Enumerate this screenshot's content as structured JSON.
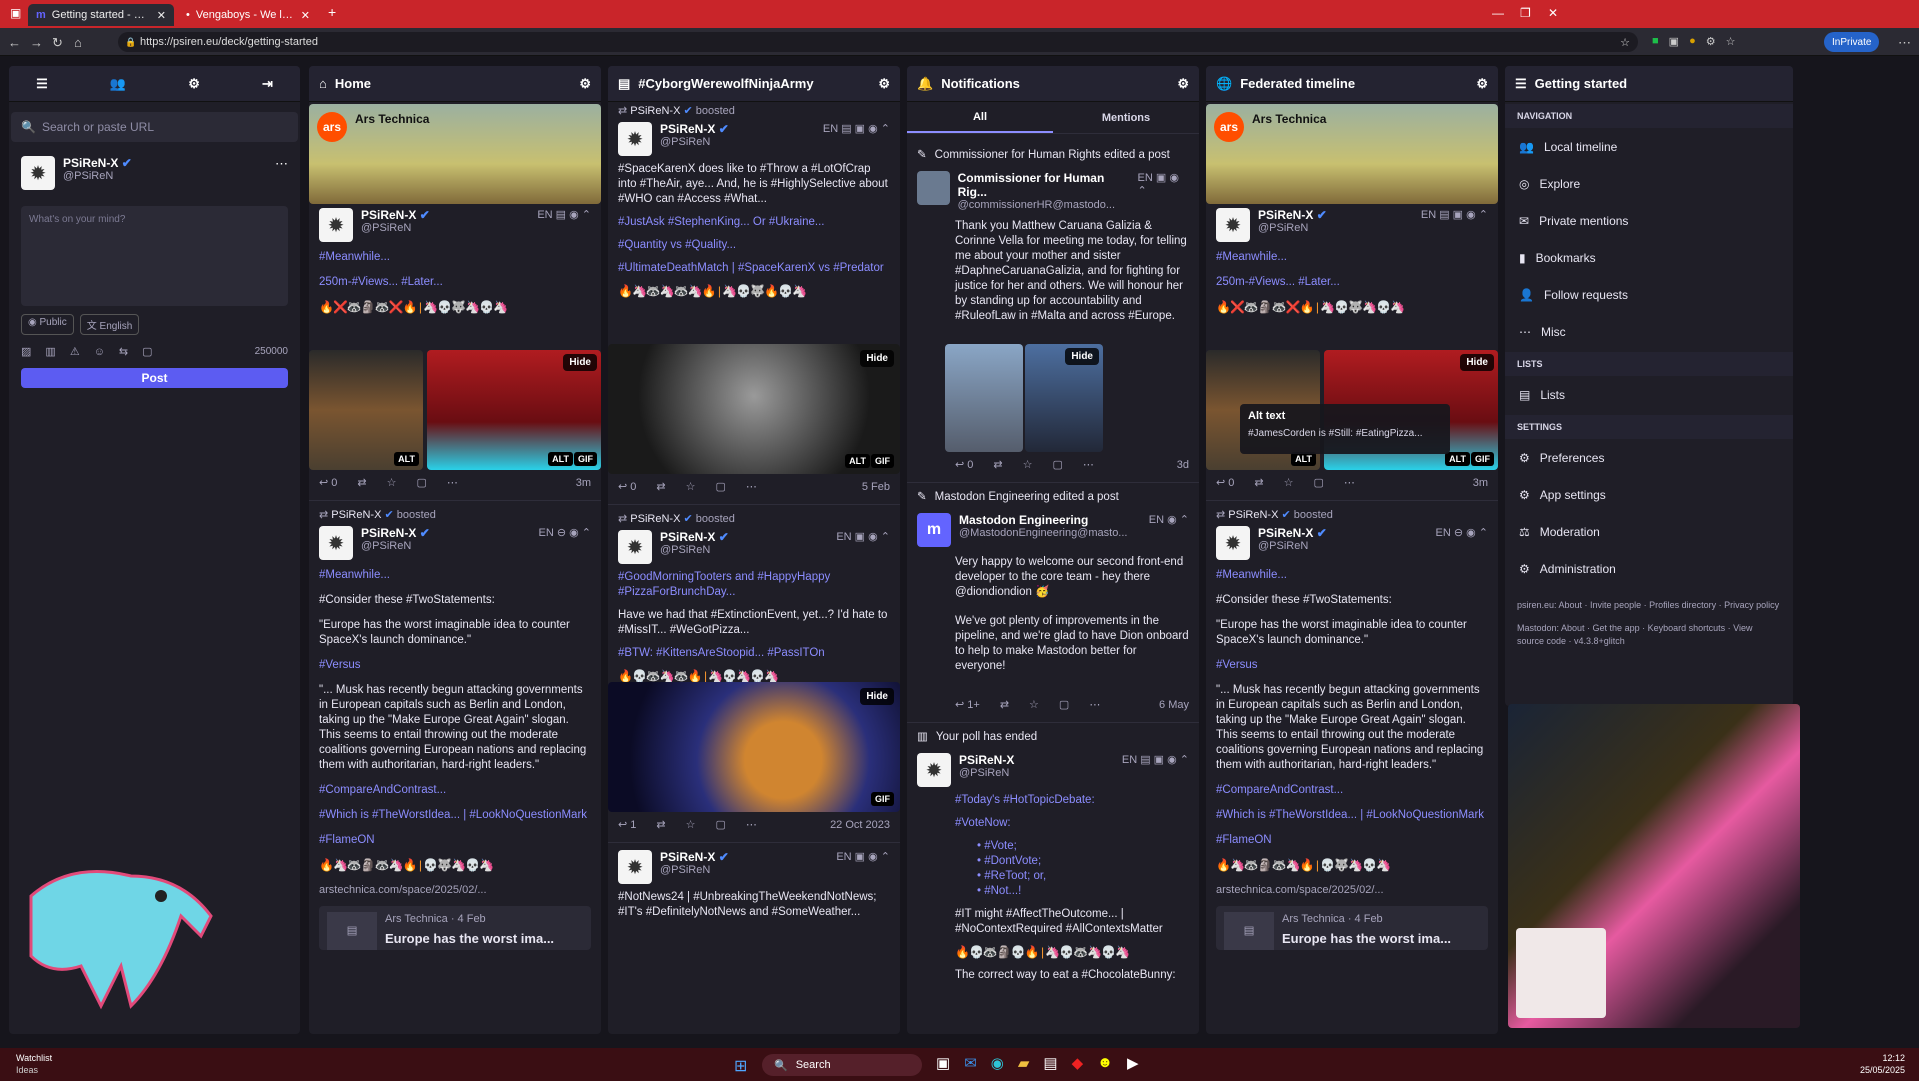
{
  "browser": {
    "tabs": [
      {
        "title": "Getting started - #MastodonSpy",
        "active": true
      },
      {
        "title": "Vengaboys - We like to Party! (Th",
        "active": false
      }
    ],
    "url": "https://psiren.eu/deck/getting-started",
    "inprivate": "InPrivate",
    "accent": "#c9252a"
  },
  "sidebar": {
    "search_placeholder": "Search or paste URL",
    "profile": {
      "name": "PSiReN-X",
      "handle": "@PSiReN"
    },
    "compose_placeholder": "What's on your mind?",
    "visibility": "Public",
    "language": "English",
    "char_count": "250000",
    "post_label": "Post"
  },
  "columns": {
    "home": {
      "title": "Home",
      "card": {
        "source": "Ars Technica"
      },
      "post1": {
        "name": "PSiReN-X",
        "handle": "@PSiReN",
        "lang": "EN",
        "lines": [
          "#Meanwhile...",
          "250m-#Views... #Later..."
        ],
        "hide": "Hide",
        "alt": "ALT",
        "alt2": "ALT",
        "gif": "GIF",
        "replies": "0",
        "time": "3m"
      },
      "boost": {
        "label": "PSiReN-X",
        "boosted": "boosted"
      },
      "post2": {
        "name": "PSiReN-X",
        "handle": "@PSiReN",
        "lang": "EN",
        "lines": [
          "#Meanwhile...",
          "#Consider these #TwoStatements:",
          "\"Europe has the worst imaginable idea to counter SpaceX's launch dominance.\"",
          "#Versus",
          "\"... Musk has recently begun attacking governments in European capitals such as Berlin and London, taking up the \"Make Europe Great Again\" slogan. This seems to entail throwing out the moderate coalitions governing European nations and replacing them with authoritarian, hard-right leaders.\"",
          "#CompareAndContrast...",
          "#Which is #TheWorstIdea... | #LookNoQuestionMark",
          "#FlameON"
        ],
        "link": "arstechnica.com/space/2025/02/...",
        "preview_source": "Ars Technica · 4 Feb",
        "preview_title": "Europe has the worst ima..."
      }
    },
    "cyborg": {
      "title": "#CyborgWerewolfNinjaArmy",
      "boost1": {
        "label": "PSiReN-X",
        "boosted": "boosted"
      },
      "post1": {
        "name": "PSiReN-X",
        "handle": "@PSiReN",
        "lang": "EN",
        "lines": [
          "#SpaceKarenX does like to #Throw a #LotOfCrap into #TheAir, aye... And, he is #HighlySelective about #WHO can #Access #What...",
          "#JustAsk #StephenKing... Or #Ukraine...",
          "#Quantity vs #Quality...",
          "#UltimateDeathMatch | #SpaceKarenX vs #Predator"
        ],
        "hide": "Hide",
        "alt": "ALT",
        "gif": "GIF",
        "replies": "0",
        "time": "5 Feb"
      },
      "boost2": {
        "label": "PSiReN-X",
        "boosted": "boosted"
      },
      "post2": {
        "name": "PSiReN-X",
        "handle": "@PSiReN",
        "lang": "EN",
        "lines": [
          "#GoodMorningTooters and #HappyHappy #PizzaForBrunchDay...",
          "Have we had that #ExtinctionEvent, yet...? I'd hate to #MissIT... #WeGotPizza...",
          "#BTW: #KittensAreStoopid... #PassITOn"
        ],
        "hide": "Hide",
        "gif": "GIF",
        "replies": "1",
        "time": "22 Oct 2023"
      },
      "post3": {
        "name": "PSiReN-X",
        "handle": "@PSiReN",
        "lang": "EN",
        "lines": [
          "#NotNews24 | #UnbreakingTheWeekendNotNews; #IT's #DefinitelyNotNews and #SomeWeather..."
        ]
      }
    },
    "notifications": {
      "title": "Notifications",
      "tab_all": "All",
      "tab_mentions": "Mentions",
      "n1": {
        "header": "Commissioner for Human Rights edited a post",
        "name": "Commissioner for Human Rig...",
        "handle": "@commissionerHR@mastodo...",
        "lang": "EN",
        "text": "Thank you Matthew Caruana Galizia & Corinne Vella for meeting me today, for telling me about your mother and sister #DaphneCaruanaGalizia, and for fighting for justice for her and others. We will honour her by standing up for accountability and #RuleofLaw in #Malta and across #Europe.",
        "hide": "Hide",
        "replies": "0",
        "time": "3d"
      },
      "n2": {
        "header": "Mastodon Engineering edited a post",
        "name": "Mastodon Engineering",
        "handle": "@MastodonEngineering@masto...",
        "lang": "EN",
        "text": "Very happy to welcome our second front-end developer to the core team - hey there @diondiondion 🥳",
        "text2": "We've got plenty of improvements in the pipeline, and we're glad to have Dion onboard to help to make Mastodon better for everyone!",
        "replies": "1+",
        "time": "6 May"
      },
      "n3": {
        "header": "Your poll has ended",
        "name": "PSiReN-X",
        "handle": "@PSiReN",
        "lang": "EN",
        "lines": [
          "#Today's #HotTopicDebate:",
          "#VoteNow:"
        ],
        "options": [
          "#Vote;",
          "#DontVote;",
          "#ReToot; or,",
          "#Not...!"
        ],
        "after": "#IT might #AffectTheOutcome... | #NoContextRequired #AllContextsMatter",
        "last": "The correct way to eat a #ChocolateBunny:"
      }
    },
    "federated": {
      "title": "Federated timeline",
      "card": {
        "source": "Ars Technica"
      },
      "post1": {
        "name": "PSiReN-X",
        "handle": "@PSiReN",
        "lang": "EN",
        "lines": [
          "#Meanwhile...",
          "250m-#Views... #Later..."
        ],
        "hide": "Hide",
        "alt_title": "Alt text",
        "alt_text": "#JamesCorden is #Still: #EatingPizza...",
        "alt": "ALT",
        "alt2": "ALT",
        "gif": "GIF",
        "replies": "0",
        "time": "3m"
      },
      "boost": {
        "label": "PSiReN-X",
        "boosted": "boosted"
      },
      "post2": {
        "name": "PSiReN-X",
        "handle": "@PSiReN",
        "lang": "EN",
        "link": "arstechnica.com/space/2025/02/...",
        "preview_source": "Ars Technica · 4 Feb",
        "preview_title": "Europe has the worst ima..."
      }
    },
    "getting_started": {
      "title": "Getting started",
      "nav_heading": "NAVIGATION",
      "nav": [
        "Local timeline",
        "Explore",
        "Private mentions",
        "Bookmarks",
        "Follow requests",
        "Misc"
      ],
      "lists_heading": "LISTS",
      "lists": [
        "Lists"
      ],
      "settings_heading": "SETTINGS",
      "settings": [
        "Preferences",
        "App settings",
        "Moderation",
        "Administration"
      ],
      "footer1": "psiren.eu: About · Invite people · Profiles directory · Privacy policy",
      "footer2": "Mastodon: About · Get the app · Keyboard shortcuts · View source code · v4.3.8+glitch"
    }
  },
  "taskbar": {
    "widget_title": "Watchlist",
    "widget_sub": "Ideas",
    "search": "Search",
    "time": "12:12",
    "date": "25/05/2025"
  }
}
